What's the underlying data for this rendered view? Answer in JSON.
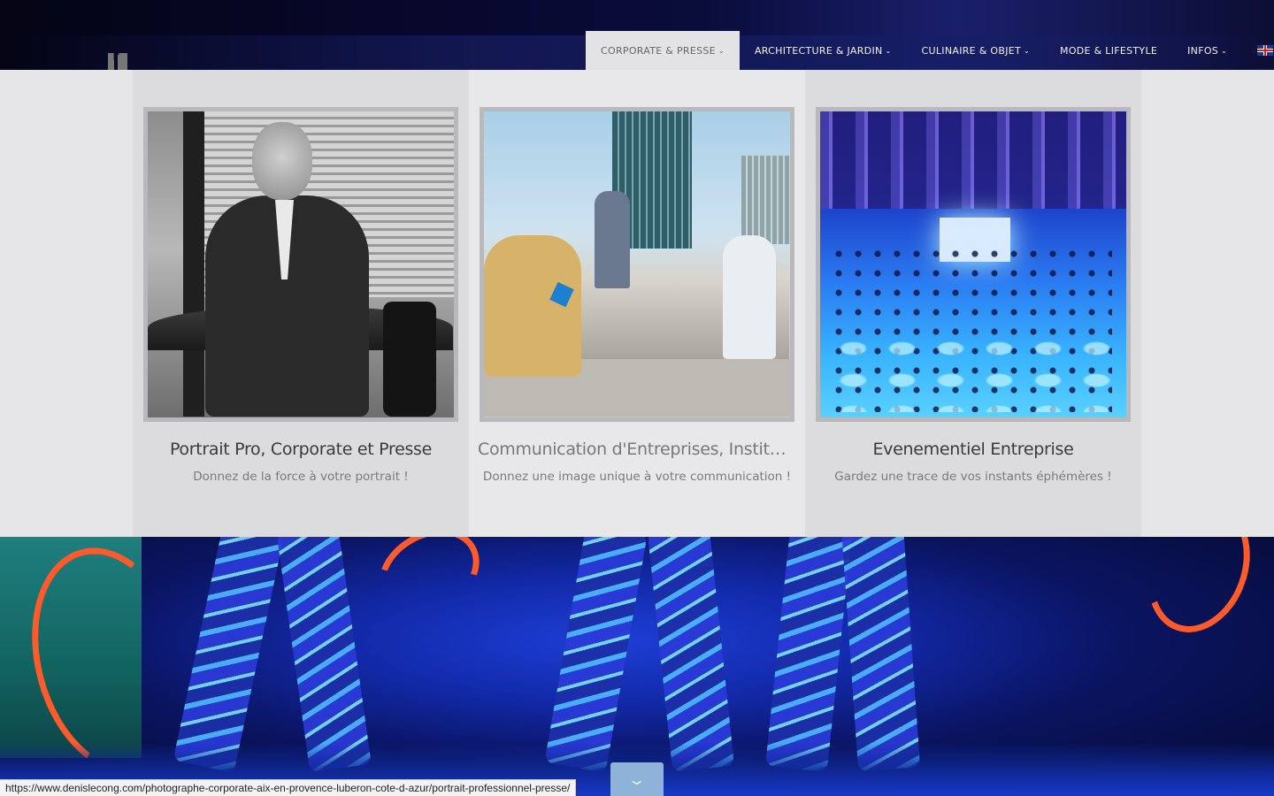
{
  "nav": {
    "items": [
      {
        "label": "CORPORATE & PRESSE",
        "caret": "⌄"
      },
      {
        "label": "ARCHITECTURE & JARDIN",
        "caret": "⌄"
      },
      {
        "label": "CULINAIRE & OBJET",
        "caret": "⌄"
      },
      {
        "label": "MODE & LIFESTYLE",
        "caret": ""
      },
      {
        "label": "INFOS",
        "caret": "⌄"
      }
    ],
    "language_icon": "uk-flag-icon"
  },
  "menu": {
    "cards": [
      {
        "title": "Portrait Pro, Corporate et Presse",
        "subtitle": "Donnez de la force à votre portrait !"
      },
      {
        "title": "Communication d'Entreprises, Institution...",
        "subtitle": "Donnez une image unique à votre communication !"
      },
      {
        "title": "Evenementiel Entreprise",
        "subtitle": "Gardez une trace de vos instants éphémères !"
      }
    ]
  },
  "scroll_button": {
    "icon": "chevron-down-icon",
    "glyph": "⌄"
  },
  "status_bar": {
    "url": "https://www.denislecong.com/photographe-corporate-aix-en-provence-luberon-cote-d-azur/portrait-professionnel-presse/"
  }
}
